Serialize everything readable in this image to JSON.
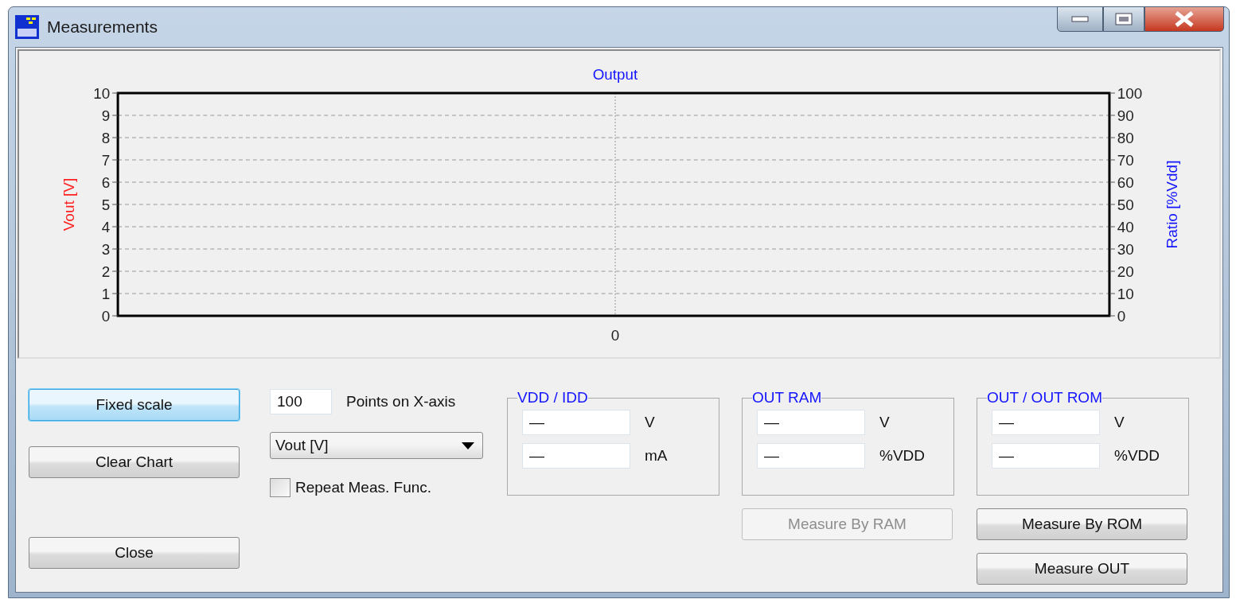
{
  "window": {
    "title": "Measurements"
  },
  "chart": {
    "title": "Output",
    "left_axis": {
      "label": "Vout [V]",
      "ticks": [
        "10",
        "9",
        "8",
        "7",
        "6",
        "5",
        "4",
        "3",
        "2",
        "1",
        "0"
      ]
    },
    "right_axis": {
      "label": "Ratio [%Vdd]",
      "ticks": [
        "100",
        "90",
        "80",
        "70",
        "60",
        "50",
        "40",
        "30",
        "20",
        "10",
        "0"
      ]
    },
    "x_tick": "0"
  },
  "left_buttons": [
    {
      "label": "Fixed scale",
      "focused": true
    },
    {
      "label": "Clear Chart",
      "focused": false
    },
    {
      "label": "Close",
      "focused": false
    }
  ],
  "points_field": {
    "value": "100",
    "label": "Points on X-axis"
  },
  "series_dropdown": {
    "value": "Vout [V]"
  },
  "repeat_checkbox": {
    "label": "Repeat Meas. Func.",
    "checked": false
  },
  "groups": [
    {
      "title": "VDD / IDD",
      "fields": [
        {
          "value": "—",
          "unit": "V"
        },
        {
          "value": "—",
          "unit": "mA"
        }
      ]
    },
    {
      "title": "OUT RAM",
      "fields": [
        {
          "value": "—",
          "unit": "V"
        },
        {
          "value": "—",
          "unit": "%VDD"
        }
      ],
      "buttons": [
        {
          "label": "Measure By RAM",
          "disabled": true
        }
      ]
    },
    {
      "title": "OUT / OUT ROM",
      "fields": [
        {
          "value": "—",
          "unit": "V"
        },
        {
          "value": "—",
          "unit": "%VDD"
        }
      ],
      "buttons": [
        {
          "label": "Measure By ROM",
          "disabled": false
        },
        {
          "label": "Measure OUT",
          "disabled": false
        }
      ]
    }
  ]
}
